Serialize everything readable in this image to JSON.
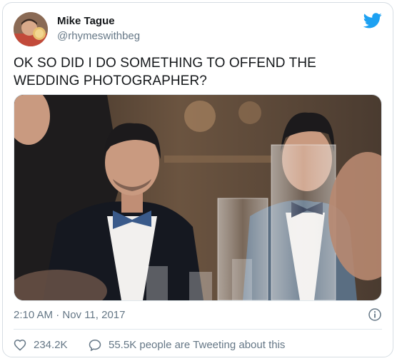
{
  "author": {
    "name": "Mike Tague",
    "handle": "@rhymeswithbeg"
  },
  "tweet": {
    "text": "OK SO DID I DO SOMETHING TO OFFEND THE WEDDING PHOTOGRAPHER?",
    "timestamp": "2:10 AM · Nov 11, 2017"
  },
  "engagement": {
    "likes": "234.2K",
    "tweeting_text": "55.5K people are Tweeting about this"
  },
  "icons": {
    "brand": "twitter-bird-icon",
    "like": "heart-icon",
    "reply": "speech-bubble-icon",
    "info": "info-icon"
  },
  "colors": {
    "brand": "#1da1f2",
    "text": "#14171a",
    "secondary": "#657786",
    "border": "#e1e8ed"
  }
}
